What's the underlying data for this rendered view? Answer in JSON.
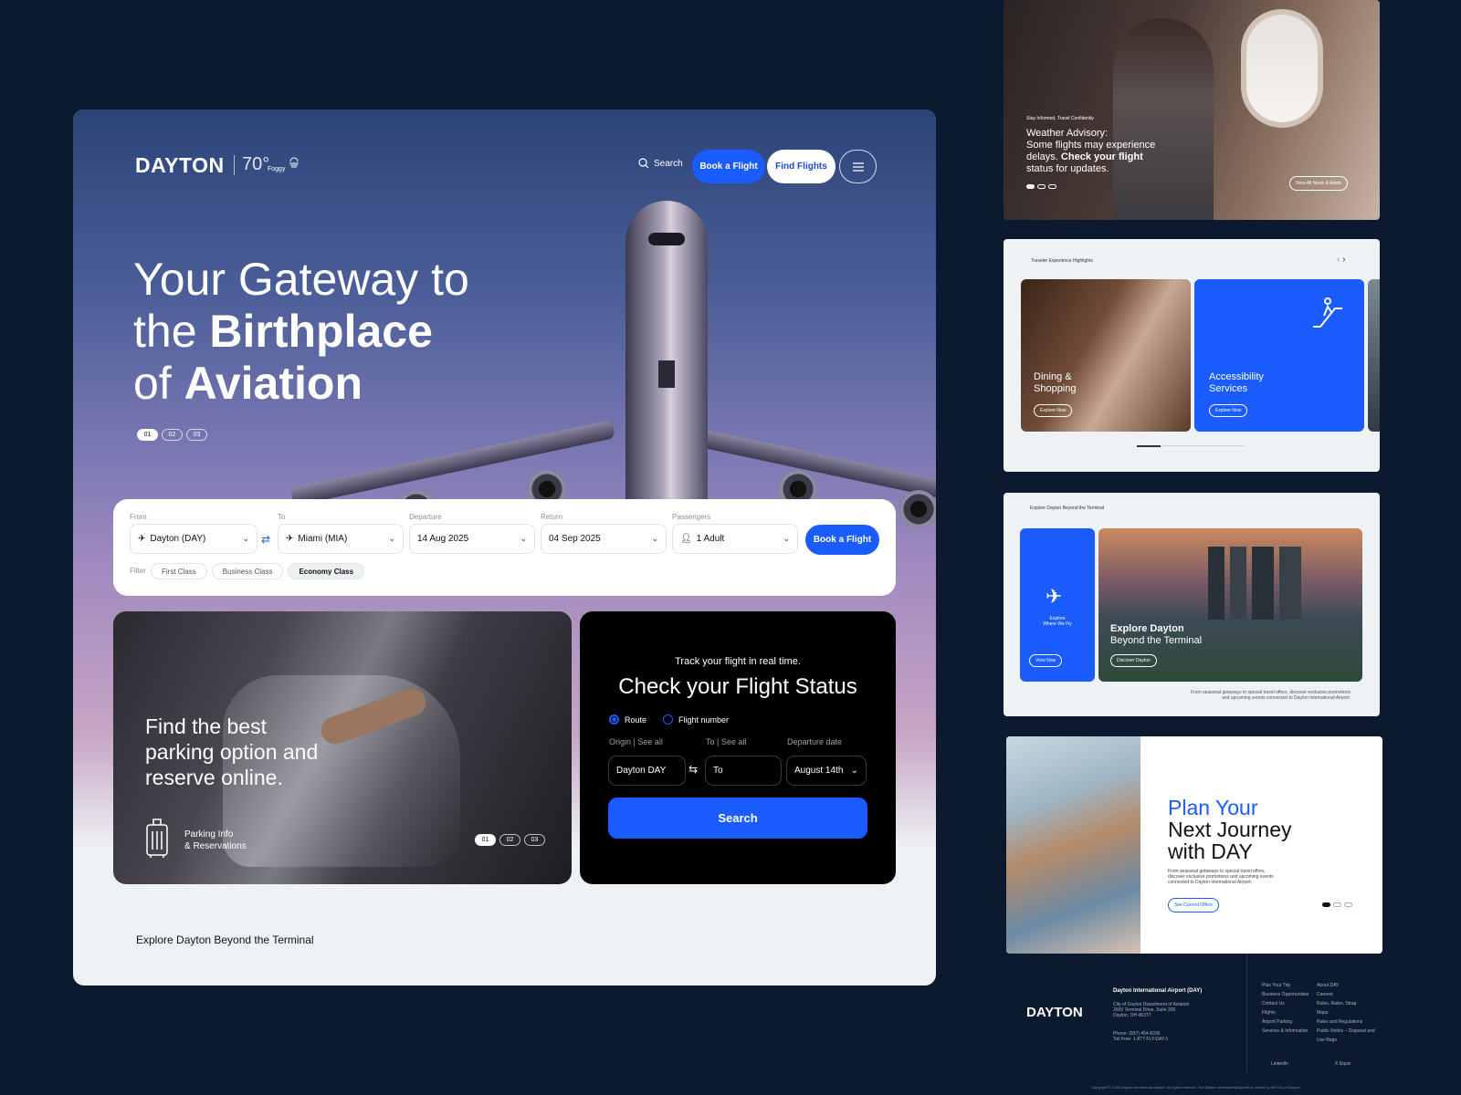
{
  "colors": {
    "page_bg": "#0b1a2e",
    "accent_blue": "#1a5cff",
    "card_dark": "#000000"
  },
  "header": {
    "logo": "DAYTON",
    "temperature": "70°",
    "weather": "Foggy",
    "search_label": "Search",
    "book_label": "Book a Flight",
    "find_label": "Find Flights"
  },
  "hero": {
    "title_line1": "Your Gateway to",
    "title_line2_light": "the ",
    "title_line2_bold": "Birthplace",
    "title_line3_light": "of ",
    "title_line3_bold": "Aviation",
    "slides": [
      "01",
      "02",
      "03"
    ]
  },
  "booking": {
    "from_label": "From",
    "from_value": "Dayton (DAY)",
    "to_label": "To",
    "to_value": "Miami (MIA)",
    "departure_label": "Departure",
    "departure_value": "14 Aug 2025",
    "return_label": "Return",
    "return_value": "04 Sep 2025",
    "passengers_label": "Passengers",
    "passengers_value": "1 Adult",
    "submit_label": "Book a Flight",
    "filter_label": "Filter",
    "filters": [
      "First Class",
      "Business Class",
      "Economy Class"
    ]
  },
  "parking": {
    "headline_line1": "Find the best",
    "headline_line2": "parking option and",
    "headline_line3": "reserve online.",
    "link_line1": "Parking Info",
    "link_line2": "& Reservations",
    "slides": [
      "01",
      "02",
      "03"
    ]
  },
  "flight_status": {
    "kicker": "Track your flight in real time.",
    "title": "Check your Flight Status",
    "radio_route": "Route",
    "radio_flight": "Flight number",
    "origin_label": "Origin | See all",
    "to_label": "To | See all",
    "date_label": "Departure date",
    "origin_value": "Dayton DAY",
    "to_placeholder": "To",
    "date_value": "August 14th",
    "search_label": "Search"
  },
  "explore_heading": "Explore Dayton Beyond the Terminal",
  "advisory": {
    "kicker": "Stay Informed, Travel Confidently",
    "line1": "Weather Advisory:",
    "line2": "Some flights may experience",
    "line3_light": "delays. ",
    "line3_bold": "Check your flight",
    "line4": "status for updates.",
    "cta": "View All News & Alerts"
  },
  "highlights": {
    "title": "Traveler Experience Highlights",
    "card1_line1": "Dining &",
    "card1_line2": "Shopping",
    "card2_line1": "Accessibility",
    "card2_line2": "Services",
    "explore": "Explore Now"
  },
  "explore_panel": {
    "title": "Explore Dayton Beyond the Terminal",
    "blue_line1": "Explore",
    "blue_line2": "Where We Fly",
    "blue_cta": "View Now",
    "city_line1": "Explore Dayton",
    "city_line2": "Beyond the Terminal",
    "city_cta": "Discover Dayton",
    "caption_line1": "From seasonal getaways to special travel offers, discover exclusive promotions",
    "caption_line2": "and upcoming events connected to Dayton International Airport."
  },
  "journey": {
    "line1": "Plan Your",
    "line2": "Next Journey",
    "line3": "with DAY",
    "copy_line1": "From seasonal getaways to special travel offers,",
    "copy_line2": "discover exclusive promotions and upcoming events",
    "copy_line3": "connected to Dayton International Airport.",
    "cta": "See Current Offers"
  },
  "footer": {
    "logo": "DAYTON",
    "org": "Dayton International Airport (DAY)",
    "addr1": "City of Dayton Department of Aviation",
    "addr2": "3600 Terminal Drive, Suite 300",
    "addr3": "Dayton, OH 45377",
    "phone": "Phone: (937) 454-8200",
    "tollfree": "Toll Free: 1-877-FLY-DAY-1",
    "links_col1": [
      "Plan Your Trip",
      "Business Opportunities",
      "Contact Us",
      "Flights",
      "Airport Parking",
      "Services & Information"
    ],
    "links_col2": [
      "About DAY",
      "Careers",
      "Rules, Rates, Strap",
      "Maps",
      "Rules and Regulations",
      "Public Notice – Disposal and Use Regs"
    ],
    "linkedin": "LinkedIn",
    "x": "X  Equix",
    "copyright": "Copyright © 2025 Dayton International Airport. All rights reserved. The Dayton International Airport is owned by the City of Dayton."
  }
}
